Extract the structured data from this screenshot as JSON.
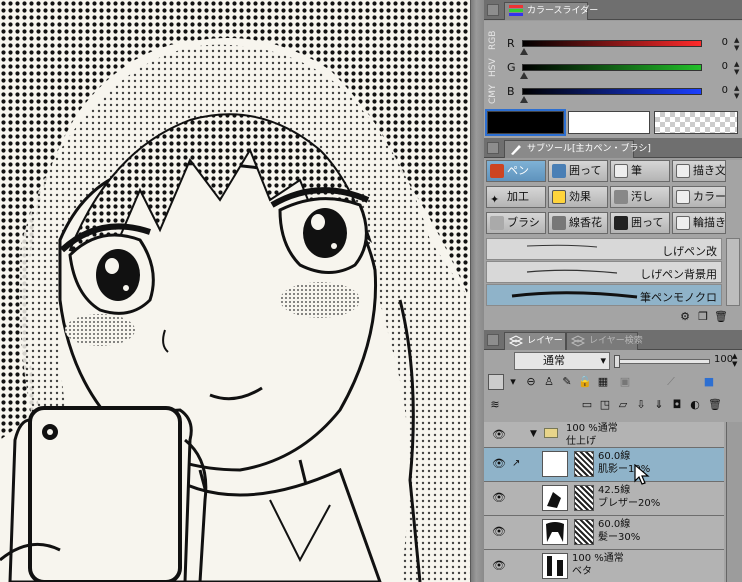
{
  "color_slider": {
    "tab_label": "カラースライダー",
    "modes": [
      "RGB",
      "HSV",
      "CMY"
    ],
    "channels": [
      {
        "label": "R",
        "value": "0",
        "color": "#ff2a2a"
      },
      {
        "label": "G",
        "value": "0",
        "color": "#22c02a"
      },
      {
        "label": "B",
        "value": "0",
        "color": "#1a3fff"
      }
    ],
    "main_color": "#000000",
    "sub_color": "#ffffff"
  },
  "subtool": {
    "tab_label": "サブツール[主カペン・ブラシ]",
    "tools": [
      {
        "label": "ペン",
        "icon": "pen-icon",
        "active": true
      },
      {
        "label": "囲って",
        "icon": "lasso-fill-icon"
      },
      {
        "label": "筆",
        "icon": "brush-icon"
      },
      {
        "label": "描き文",
        "icon": "text-brush-icon"
      },
      {
        "label": "加工",
        "icon": "sparkle-icon"
      },
      {
        "label": "効果",
        "icon": "effect-icon"
      },
      {
        "label": "汚し",
        "icon": "smudge-icon"
      },
      {
        "label": "カラー",
        "icon": "color-brush-icon"
      },
      {
        "label": "ブラシ",
        "icon": "airbrush-icon"
      },
      {
        "label": "線香花",
        "icon": "stroke-icon"
      },
      {
        "label": "囲って",
        "icon": "fill-icon"
      },
      {
        "label": "輪描き",
        "icon": "outline-icon"
      }
    ],
    "brushes": [
      {
        "name": "しげペン改"
      },
      {
        "name": "しげペン背景用"
      },
      {
        "name": "筆ペンモノクロ",
        "selected": true
      }
    ]
  },
  "layer_panel": {
    "tabs": [
      "レイヤー",
      "レイヤー検索"
    ],
    "blend_mode": "通常",
    "opacity": "100",
    "layers": [
      {
        "type": "folder",
        "line1": "100 %通常",
        "line2": "仕上げ"
      },
      {
        "line1": "60.0線",
        "line2": "肌影ー10%",
        "selected": true
      },
      {
        "line1": "42.5線",
        "line2": "ブレザー20%"
      },
      {
        "line1": "60.0線",
        "line2": "髪ー30%"
      },
      {
        "line1": "100 %通常",
        "line2": "ベタ"
      }
    ]
  }
}
